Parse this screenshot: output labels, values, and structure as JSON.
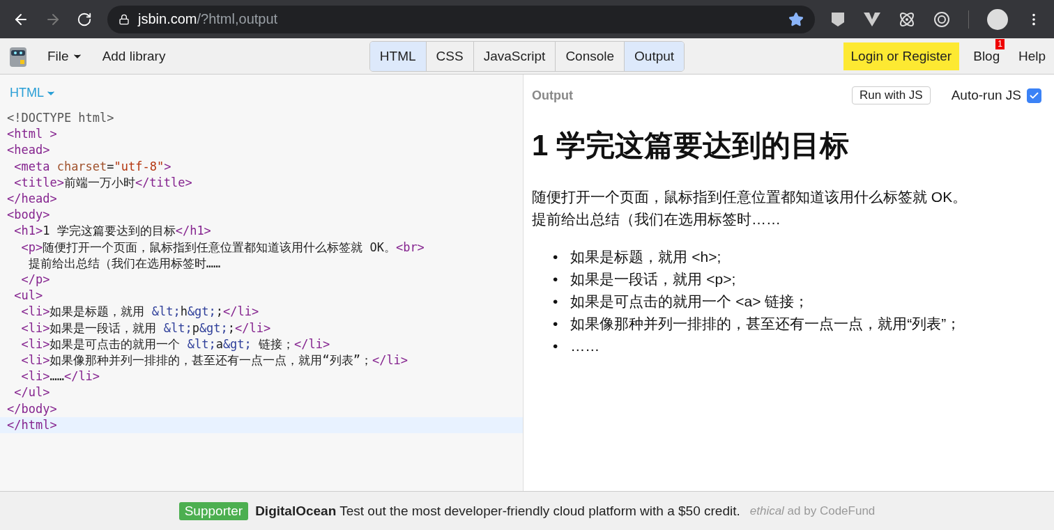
{
  "browser": {
    "url_host": "jsbin.com",
    "url_path": "/?html,output",
    "bookmarked": true
  },
  "toolbar": {
    "menu": [
      {
        "label": "File",
        "dropdown": true
      },
      {
        "label": "Add library",
        "dropdown": false
      }
    ],
    "tabs": [
      {
        "label": "HTML",
        "selected": true
      },
      {
        "label": "CSS",
        "selected": false
      },
      {
        "label": "JavaScript",
        "selected": false
      },
      {
        "label": "Console",
        "selected": false
      },
      {
        "label": "Output",
        "selected": true
      }
    ],
    "login": "Login or Register",
    "blog": {
      "label": "Blog",
      "badge": "1"
    },
    "help": "Help"
  },
  "editor": {
    "title": "HTML",
    "lines": [
      {
        "current": false,
        "tokens": [
          {
            "kind": "doctype",
            "text": "<!DOCTYPE html>"
          }
        ]
      },
      {
        "current": false,
        "tokens": [
          {
            "kind": "tag",
            "text": "<html >"
          }
        ]
      },
      {
        "current": false,
        "tokens": [
          {
            "kind": "tag",
            "text": "<head>"
          }
        ],
        "children": [
          {
            "current": false,
            "tokens": [
              {
                "kind": "tag",
                "text": "<meta "
              },
              {
                "kind": "attr",
                "text": "charset"
              },
              {
                "kind": "text",
                "text": "="
              },
              {
                "kind": "string",
                "text": "\"utf-8\""
              },
              {
                "kind": "tag",
                "text": ">"
              }
            ]
          },
          {
            "current": false,
            "tokens": [
              {
                "kind": "tag",
                "text": "<title>"
              },
              {
                "kind": "text",
                "text": "前端一万小时"
              },
              {
                "kind": "tag",
                "text": "</title>"
              }
            ]
          }
        ]
      },
      {
        "current": false,
        "tokens": [
          {
            "kind": "tag",
            "text": "</head>"
          }
        ]
      },
      {
        "current": false,
        "tokens": [
          {
            "kind": "tag",
            "text": "<body>"
          }
        ],
        "children": [
          {
            "current": false,
            "tokens": [
              {
                "kind": "tag",
                "text": "<h1>"
              },
              {
                "kind": "text",
                "text": "1 学完这篇要达到的目标"
              },
              {
                "kind": "tag",
                "text": "</h1>"
              }
            ],
            "children": [
              {
                "current": false,
                "tokens": [
                  {
                    "kind": "tag",
                    "text": "<p>"
                  },
                  {
                    "kind": "text",
                    "text": "随便打开一个页面，鼠标指到任意位置都知道该用什么标签就 OK。"
                  },
                  {
                    "kind": "tag",
                    "text": "<br>"
                  }
                ],
                "children": [
                  {
                    "current": false,
                    "tokens": [
                      {
                        "kind": "text",
                        "text": "提前给出总结（我们在选用标签时……"
                      }
                    ]
                  }
                ]
              },
              {
                "current": false,
                "tokens": [
                  {
                    "kind": "tag",
                    "text": "</p>"
                  }
                ]
              }
            ]
          },
          {
            "current": false,
            "tokens": [
              {
                "kind": "tag",
                "text": "<ul>"
              }
            ],
            "children": [
              {
                "current": false,
                "tokens": [
                  {
                    "kind": "tag",
                    "text": "<li>"
                  },
                  {
                    "kind": "text",
                    "text": "如果是标题，就用 "
                  },
                  {
                    "kind": "entity",
                    "text": "&lt;"
                  },
                  {
                    "kind": "text",
                    "text": "h"
                  },
                  {
                    "kind": "entity",
                    "text": "&gt;"
                  },
                  {
                    "kind": "text",
                    "text": ";"
                  },
                  {
                    "kind": "tag",
                    "text": "</li>"
                  }
                ]
              },
              {
                "current": false,
                "tokens": [
                  {
                    "kind": "tag",
                    "text": "<li>"
                  },
                  {
                    "kind": "text",
                    "text": "如果是一段话，就用 "
                  },
                  {
                    "kind": "entity",
                    "text": "&lt;"
                  },
                  {
                    "kind": "text",
                    "text": "p"
                  },
                  {
                    "kind": "entity",
                    "text": "&gt;"
                  },
                  {
                    "kind": "text",
                    "text": ";"
                  },
                  {
                    "kind": "tag",
                    "text": "</li>"
                  }
                ]
              },
              {
                "current": false,
                "tokens": [
                  {
                    "kind": "tag",
                    "text": "<li>"
                  },
                  {
                    "kind": "text",
                    "text": "如果是可点击的就用一个 "
                  },
                  {
                    "kind": "entity",
                    "text": "&lt;"
                  },
                  {
                    "kind": "text",
                    "text": "a"
                  },
                  {
                    "kind": "entity",
                    "text": "&gt;"
                  },
                  {
                    "kind": "text",
                    "text": " 链接；"
                  },
                  {
                    "kind": "tag",
                    "text": "</li>"
                  }
                ]
              },
              {
                "current": false,
                "tokens": [
                  {
                    "kind": "tag",
                    "text": "<li>"
                  },
                  {
                    "kind": "text",
                    "text": "如果像那种并列一排排的，甚至还有一点一点，就用“列表”；"
                  },
                  {
                    "kind": "tag",
                    "text": "</li>"
                  }
                ]
              },
              {
                "current": false,
                "tokens": [
                  {
                    "kind": "tag",
                    "text": "<li>"
                  },
                  {
                    "kind": "text",
                    "text": "……"
                  },
                  {
                    "kind": "tag",
                    "text": "</li>"
                  }
                ]
              }
            ]
          },
          {
            "current": false,
            "tokens": [
              {
                "kind": "tag",
                "text": "</ul>"
              }
            ]
          }
        ]
      },
      {
        "current": false,
        "tokens": [
          {
            "kind": "tag",
            "text": "</body>"
          }
        ]
      },
      {
        "current": true,
        "tokens": [
          {
            "kind": "tag",
            "text": "</html>"
          }
        ]
      }
    ]
  },
  "output": {
    "title": "Output",
    "run_button": "Run with JS",
    "autorun": {
      "label": "Auto-run JS",
      "checked": true
    },
    "heading": "1 学完这篇要达到的目标",
    "paragraph": [
      "随便打开一个页面，鼠标指到任意位置都知道该用什么标签就 OK。",
      "提前给出总结（我们在选用标签时……"
    ],
    "list": [
      {
        "marker": "•",
        "text": "如果是标题，就用 <h>;"
      },
      {
        "marker": "•",
        "text": "如果是一段话，就用 <p>;"
      },
      {
        "marker": "•",
        "text": "如果是可点击的就用一个 <a> 链接；"
      },
      {
        "marker": "•",
        "text": "如果像那种并列一排排的，甚至还有一点一点，就用“列表”；"
      },
      {
        "marker": "•",
        "text": "……"
      }
    ]
  },
  "ad": {
    "badge": "Supporter",
    "text": "**DigitalOcean** Test out the most developer-friendly cloud platform with a $50 credit.",
    "credit": "*ethical* ad by CodeFund"
  }
}
